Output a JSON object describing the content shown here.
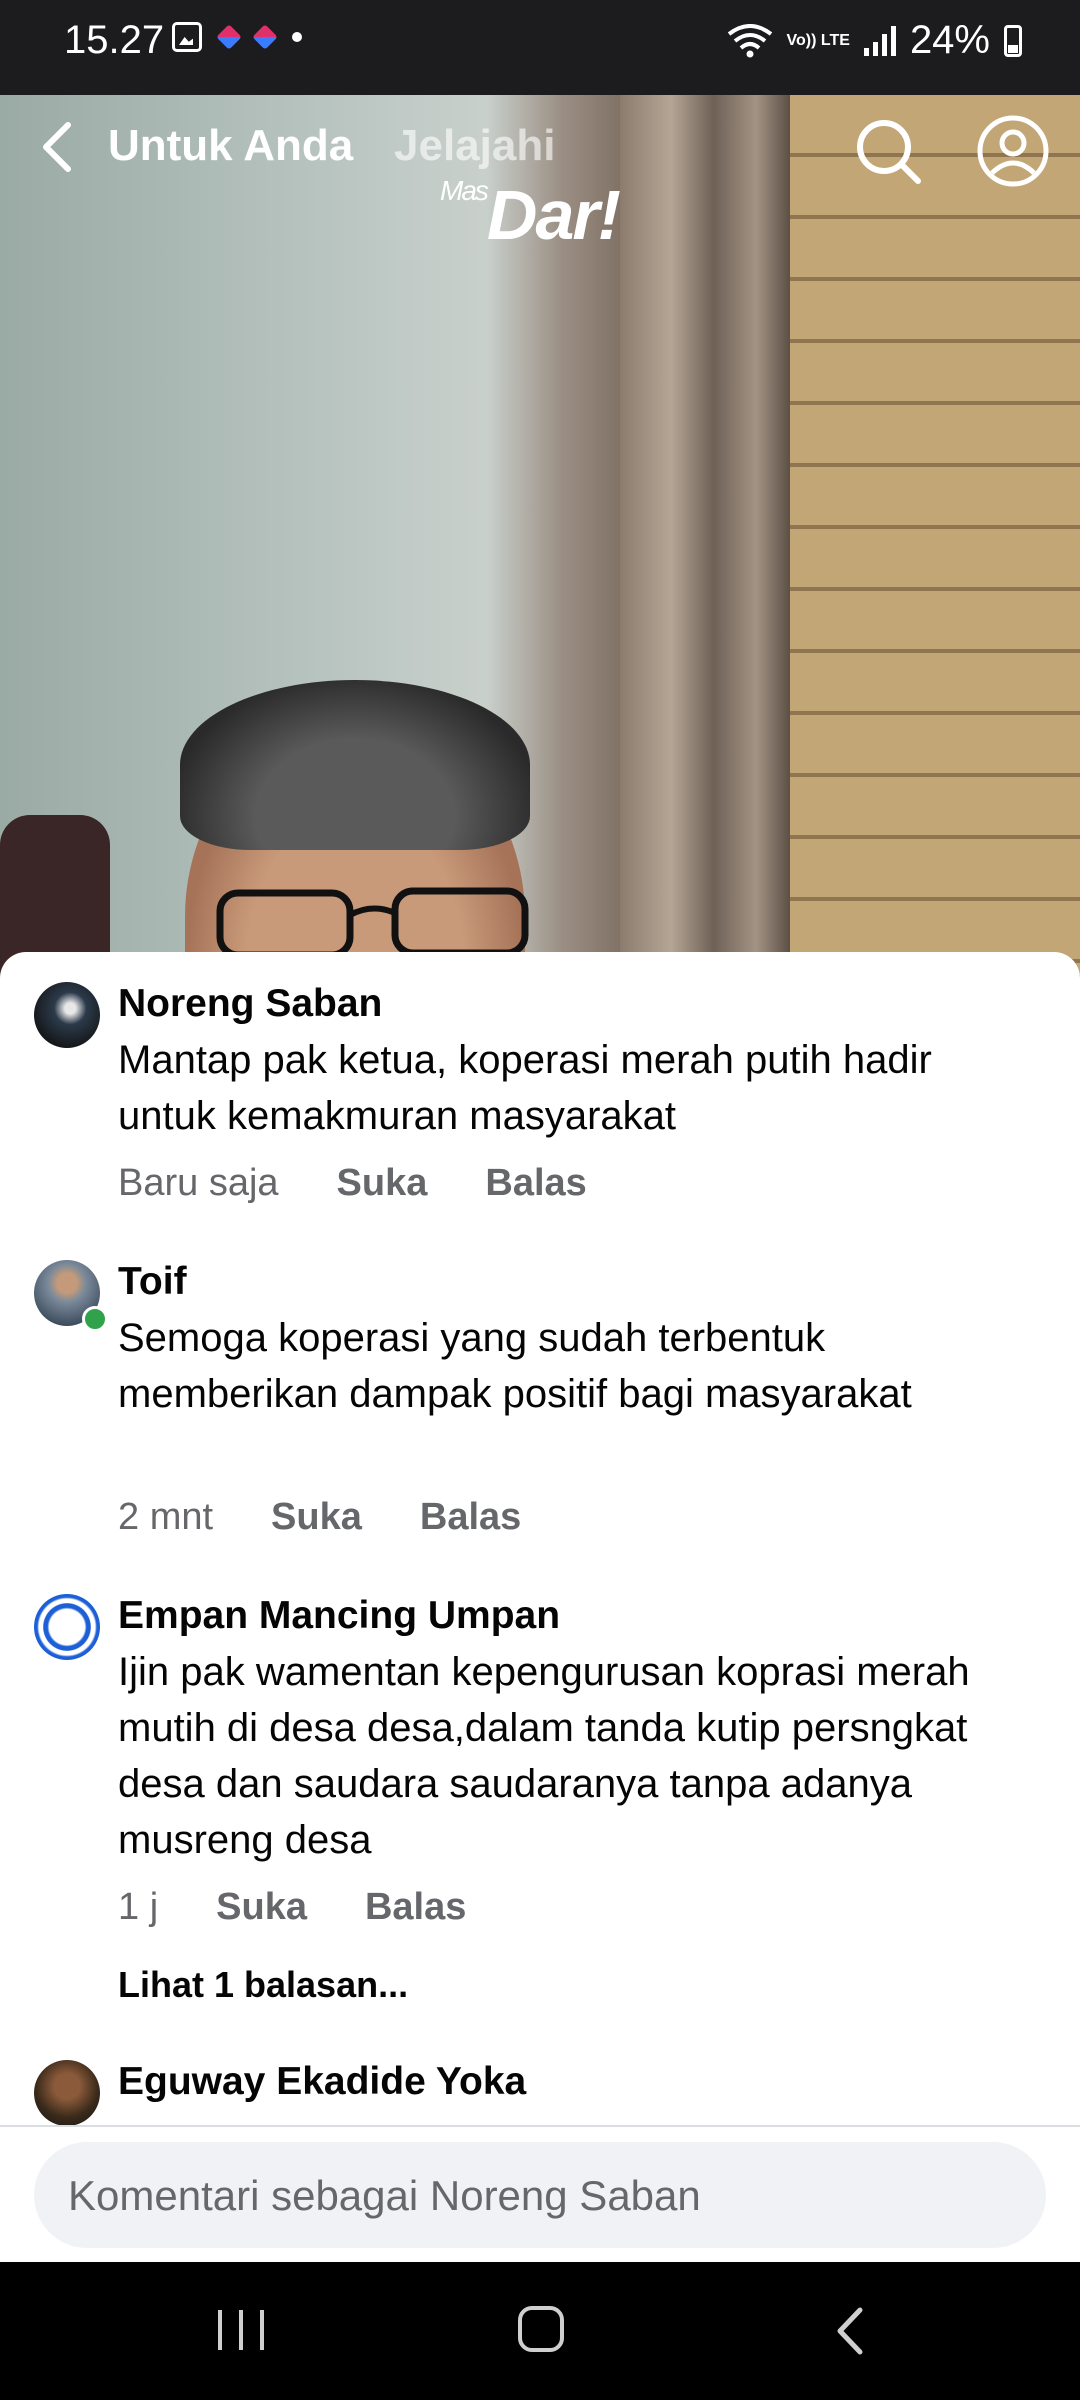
{
  "status_bar": {
    "time": "15.27",
    "network_label": "Vo)) LTE",
    "battery": "24%"
  },
  "video_header": {
    "tabs": [
      "Untuk Anda",
      "Jelajahi"
    ],
    "logo_small": "Mas",
    "logo_main": "Dar!"
  },
  "comments": [
    {
      "name": "Noreng Saban",
      "text": "Mantap pak ketua, koperasi merah putih hadir untuk kemakmuran masyarakat",
      "time": "Baru saja",
      "like": "Suka",
      "reply": "Balas"
    },
    {
      "name": "Toif",
      "text": "Semoga koperasi yang sudah terbentuk memberikan dampak positif bagi masyarakat",
      "time": "2 mnt",
      "like": "Suka",
      "reply": "Balas"
    },
    {
      "name": "Empan Mancing Umpan",
      "text": "Ijin pak wamentan kepengurusan koprasi merah mutih di desa desa,dalam tanda kutip persngkat desa dan saudara saudaranya tanpa adanya musreng desa",
      "time": "1 j",
      "like": "Suka",
      "reply": "Balas",
      "view_replies": "Lihat 1 balasan..."
    },
    {
      "name": "Eguway Ekadide Yoka"
    }
  ],
  "comment_input": {
    "placeholder": "Komentari sebagai Noreng Saban"
  },
  "colors": {
    "sheet_bg": "#ffffff",
    "meta_text": "#65676b",
    "input_bg": "#f0f2f5",
    "online": "#31a24c"
  }
}
